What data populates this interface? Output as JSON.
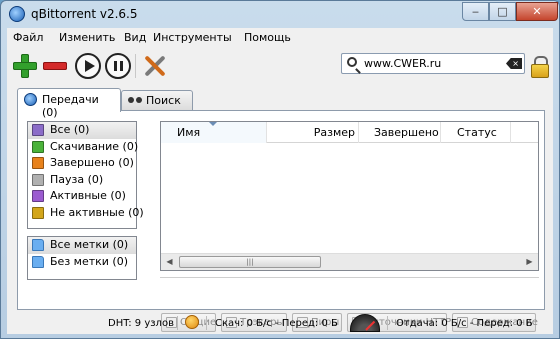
{
  "window": {
    "title": "qBittorrent v2.6.5",
    "minimize": "‒",
    "maximize": "□",
    "close": "✕"
  },
  "menu": {
    "file": "Файл",
    "edit": "Изменить",
    "view": "Вид",
    "tools": "Инструменты",
    "help": "Помощь"
  },
  "toolbar": {
    "search_value": "www.CWER.ru",
    "clear_glyph": "×",
    "icons": [
      "add-icon",
      "remove-icon",
      "resume-icon",
      "pause-icon",
      "options-icon",
      "lock-icon"
    ],
    "colors": {
      "add": "#32a02c",
      "remove": "#d42a2a"
    }
  },
  "tabs": {
    "transfers": "Передачи (0)",
    "search": "Поиск"
  },
  "sidebar": {
    "status_filters": [
      {
        "label": "Все (0)",
        "icon": "all-icon"
      },
      {
        "label": "Скачивание (0)",
        "icon": "downloading-icon"
      },
      {
        "label": "Завершено (0)",
        "icon": "completed-icon"
      },
      {
        "label": "Пауза (0)",
        "icon": "paused-icon"
      },
      {
        "label": "Активные (0)",
        "icon": "active-icon"
      },
      {
        "label": "Не активные (0)",
        "icon": "inactive-icon"
      }
    ],
    "label_filters": [
      {
        "label": "Все метки (0)",
        "icon": "folder-icon"
      },
      {
        "label": "Без метки (0)",
        "icon": "folder-icon"
      }
    ]
  },
  "table": {
    "columns": [
      "Имя",
      "Размер",
      "Завершено",
      "Статус"
    ],
    "rows": [],
    "scroll_grip": "|||",
    "scroll_left": "◀",
    "scroll_right": "▶"
  },
  "properties_tabs": {
    "general": "Общие",
    "trackers": "Трэкеры",
    "peers": "Пиры",
    "http_sources": "Источники HTTP",
    "content": "Содержание"
  },
  "statusbar": {
    "dht": "DHT: 9 узлов",
    "download": "Скач: 0 Б/с - Перед: 0 Б",
    "upload": "Отдача: 0 Б/с - Перед: 0 Б"
  }
}
